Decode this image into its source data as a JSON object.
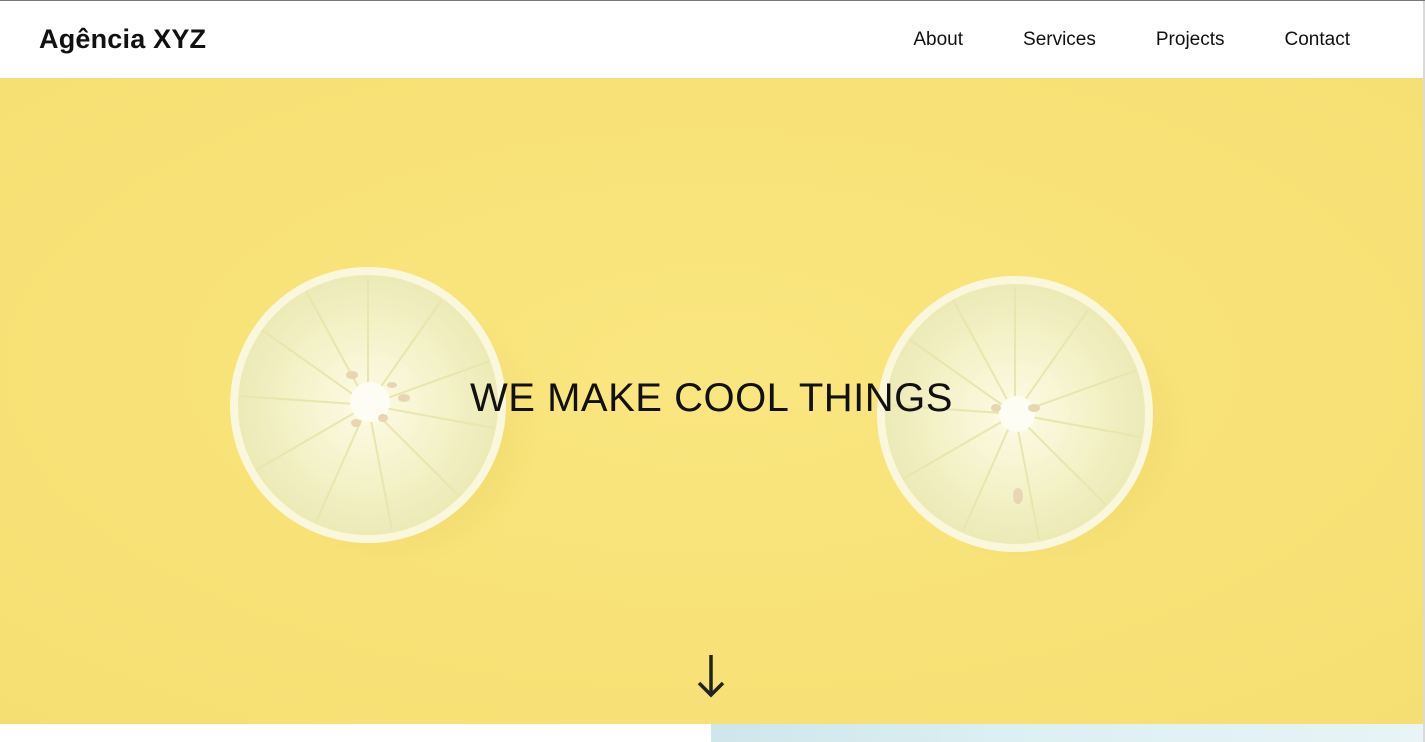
{
  "header": {
    "brand": "Agência XYZ",
    "nav": [
      {
        "label": "About"
      },
      {
        "label": "Services"
      },
      {
        "label": "Projects"
      },
      {
        "label": "Contact"
      }
    ]
  },
  "hero": {
    "title": "WE MAKE COOL THINGS",
    "background_color": "#f8e27a",
    "scroll_icon": "arrow-down-icon"
  },
  "colors": {
    "text": "#111111",
    "header_bg": "#ffffff"
  }
}
